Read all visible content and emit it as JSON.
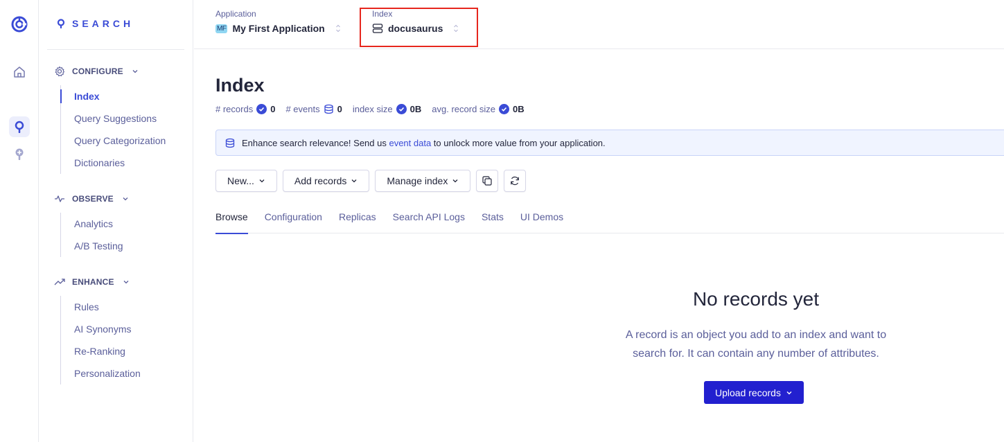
{
  "rail": {
    "icons": [
      "algolia-logo-icon",
      "home-icon",
      "search-app-icon",
      "recommend-icon"
    ]
  },
  "sidebar": {
    "brand": "SEARCH",
    "sections": [
      {
        "title": "CONFIGURE",
        "icon": "gear-icon",
        "items": [
          "Index",
          "Query Suggestions",
          "Query Categorization",
          "Dictionaries"
        ],
        "active": "Index"
      },
      {
        "title": "OBSERVE",
        "icon": "pulse-icon",
        "items": [
          "Analytics",
          "A/B Testing"
        ]
      },
      {
        "title": "ENHANCE",
        "icon": "trending-up-icon",
        "items": [
          "Rules",
          "AI Synonyms",
          "Re-Ranking",
          "Personalization"
        ]
      }
    ]
  },
  "topbar": {
    "application": {
      "label": "Application",
      "badge": "MF",
      "value": "My First Application"
    },
    "index": {
      "label": "Index",
      "value": "docusaurus"
    }
  },
  "main": {
    "title": "Index",
    "metrics": [
      {
        "label": "# records",
        "value": "0",
        "icon": "check-circle-icon"
      },
      {
        "label": "# events",
        "value": "0",
        "icon": "database-icon"
      },
      {
        "label": "index size",
        "value": "0B",
        "icon": "check-circle-icon"
      },
      {
        "label": "avg. record size",
        "value": "0B",
        "icon": "check-circle-icon"
      }
    ],
    "banner": {
      "prefix": "Enhance search relevance! Send us ",
      "link": "event data",
      "suffix": " to unlock more value from your application."
    },
    "toolbar": {
      "new": "New...",
      "add_records": "Add records",
      "manage_index": "Manage index"
    },
    "tabs": [
      "Browse",
      "Configuration",
      "Replicas",
      "Search API Logs",
      "Stats",
      "UI Demos"
    ],
    "active_tab": "Browse",
    "empty": {
      "title": "No records yet",
      "line1": "A record is an object you add to an index and want to",
      "line2": "search for. It can contain any number of attributes.",
      "button": "Upload records"
    }
  },
  "colors": {
    "accent": "#3a4bd6",
    "primary_button": "#2220cf",
    "highlight": "#e6261d"
  }
}
